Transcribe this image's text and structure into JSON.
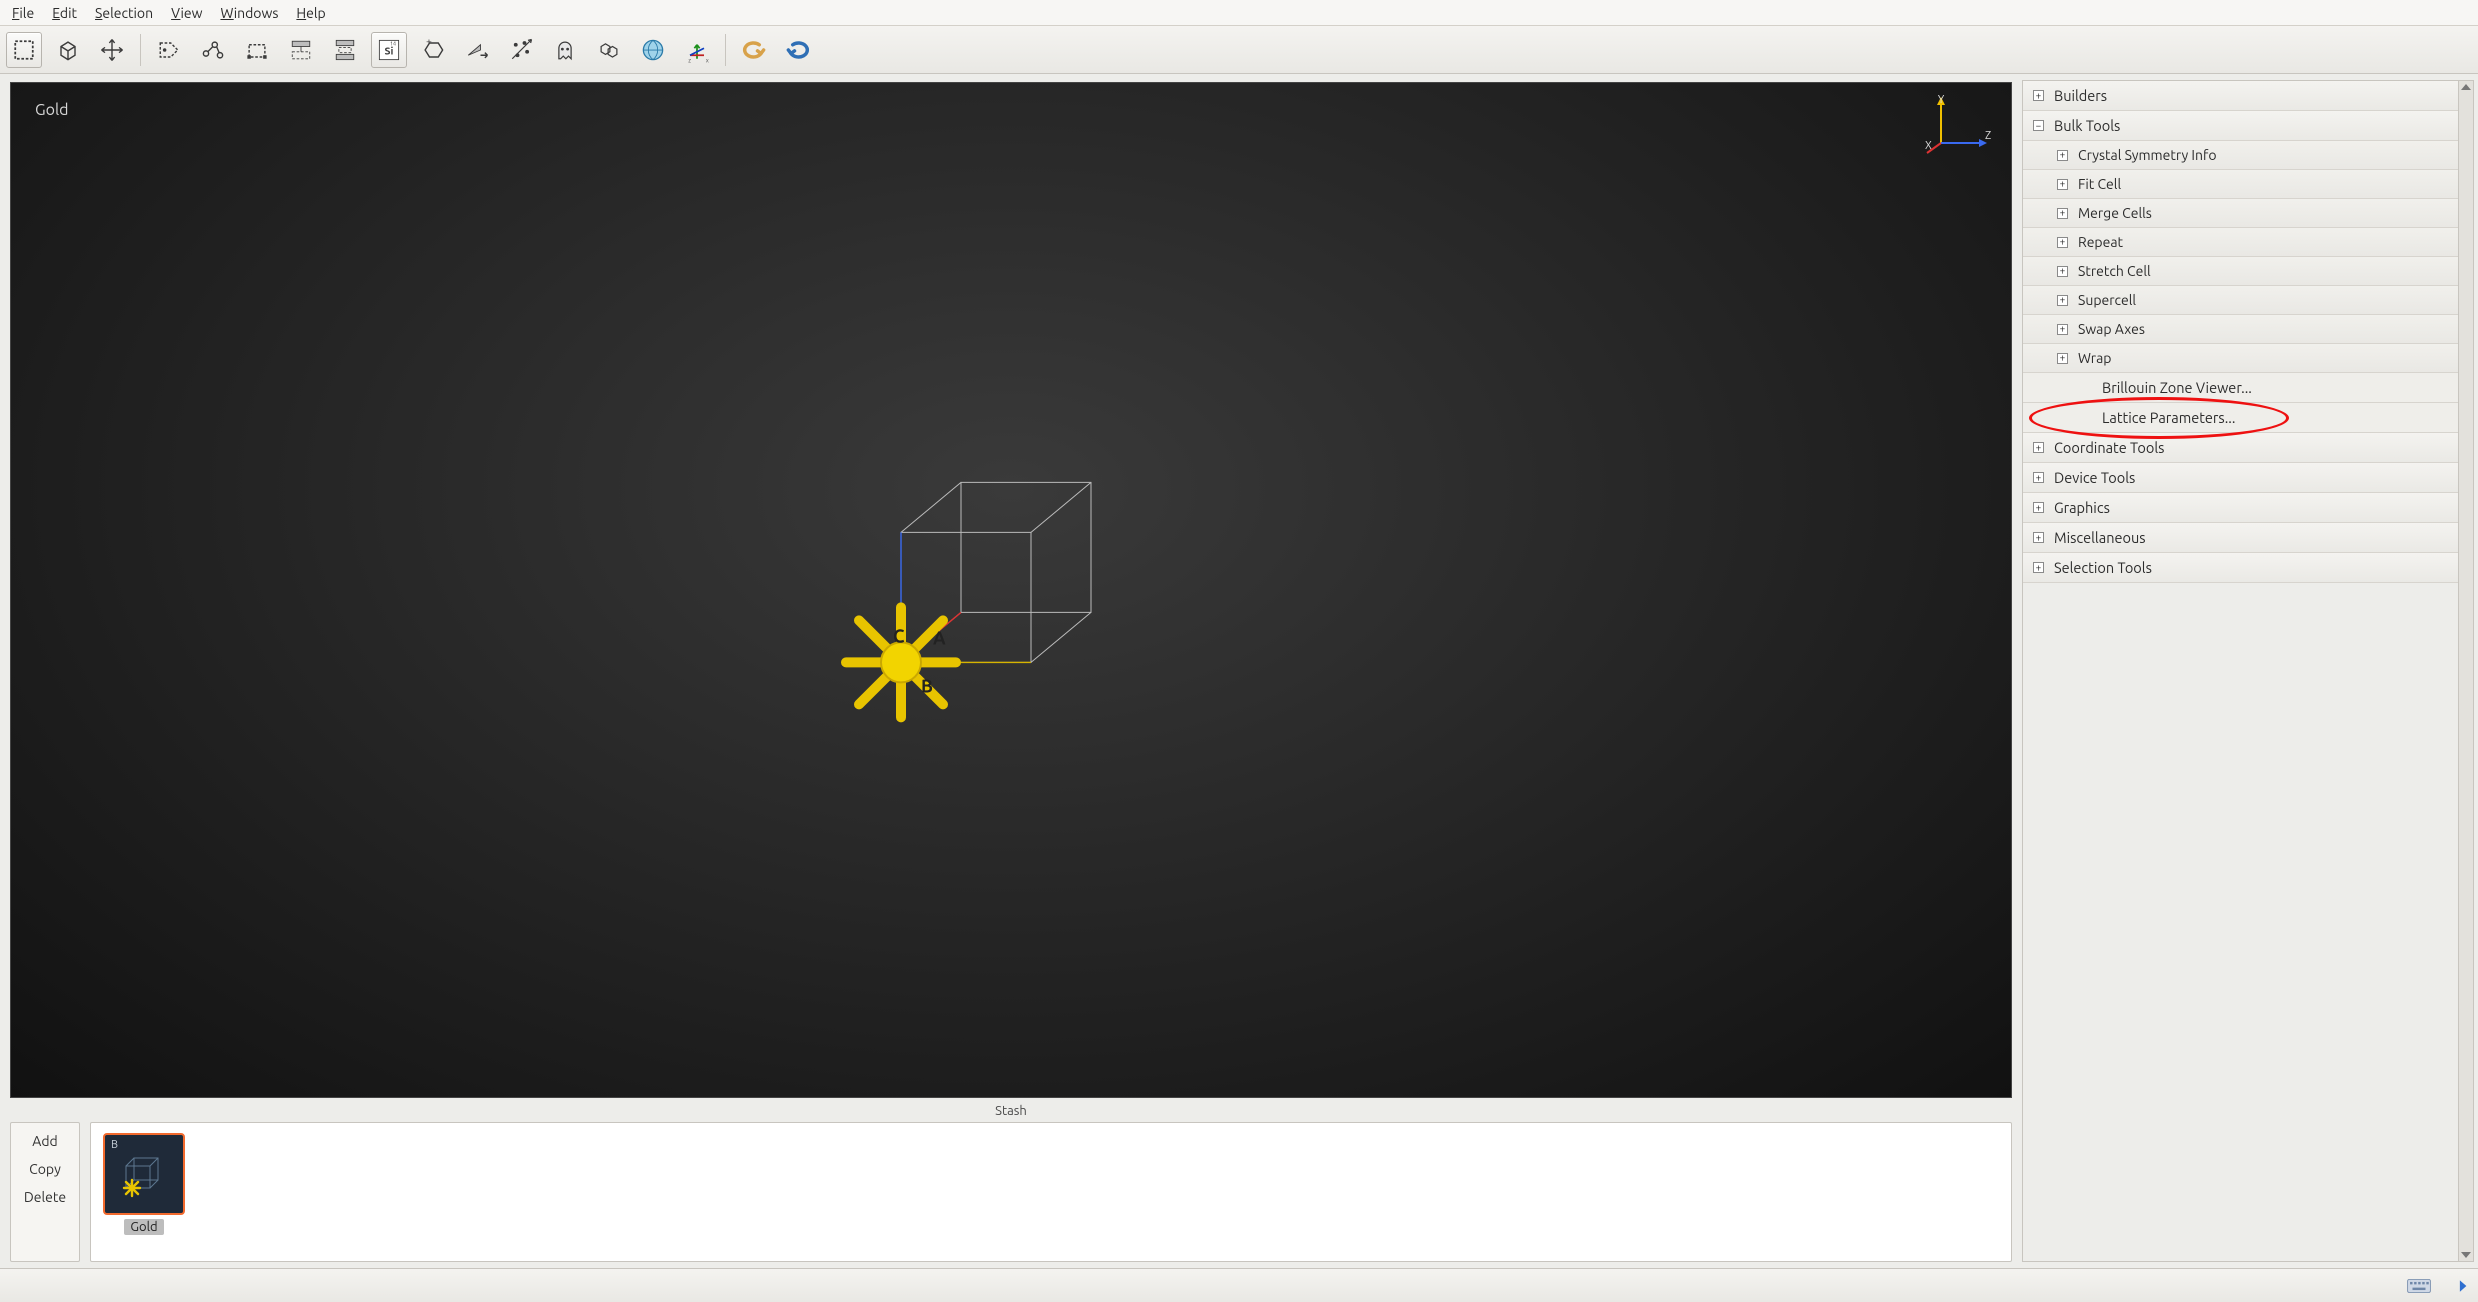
{
  "menu": {
    "items": [
      "File",
      "Edit",
      "Selection",
      "View",
      "Windows",
      "Help"
    ]
  },
  "toolbar": {
    "icons": [
      "select-rect",
      "cube",
      "move",
      "tag",
      "bond-graph",
      "crop-bounds",
      "surface-top",
      "surface-both",
      "periodic-si",
      "hex-plus",
      "wedge-arrow",
      "scatter-tool",
      "ghost",
      "hex-pair",
      "globe-blue",
      "axis-rotate",
      "undo",
      "redo"
    ]
  },
  "viewport": {
    "label": "Gold",
    "axis_labels": {
      "x": "X",
      "y": "Y",
      "z": "Z"
    },
    "cell_labels": {
      "a": "A",
      "b": "B",
      "c": "C"
    }
  },
  "stash": {
    "title": "Stash",
    "buttons": [
      "Add",
      "Copy",
      "Delete"
    ],
    "items": [
      {
        "corner": "B",
        "caption": "Gold"
      }
    ]
  },
  "side_panel": {
    "sections": [
      {
        "label": "Builders",
        "state": "collapsed"
      },
      {
        "label": "Bulk Tools",
        "state": "expanded",
        "children": [
          {
            "label": "Crystal Symmetry Info",
            "type": "sub"
          },
          {
            "label": "Fit Cell",
            "type": "sub"
          },
          {
            "label": "Merge Cells",
            "type": "sub"
          },
          {
            "label": "Repeat",
            "type": "sub"
          },
          {
            "label": "Stretch Cell",
            "type": "sub"
          },
          {
            "label": "Supercell",
            "type": "sub"
          },
          {
            "label": "Swap Axes",
            "type": "sub"
          },
          {
            "label": "Wrap",
            "type": "sub"
          },
          {
            "label": "Brillouin Zone Viewer...",
            "type": "leaf"
          },
          {
            "label": "Lattice Parameters...",
            "type": "leaf",
            "highlighted": true
          }
        ]
      },
      {
        "label": "Coordinate Tools",
        "state": "collapsed"
      },
      {
        "label": "Device Tools",
        "state": "collapsed"
      },
      {
        "label": "Graphics",
        "state": "collapsed"
      },
      {
        "label": "Miscellaneous",
        "state": "collapsed"
      },
      {
        "label": "Selection Tools",
        "state": "collapsed"
      }
    ]
  },
  "statusbar": {
    "icons": [
      "keyboard",
      "forward-arrow"
    ]
  }
}
